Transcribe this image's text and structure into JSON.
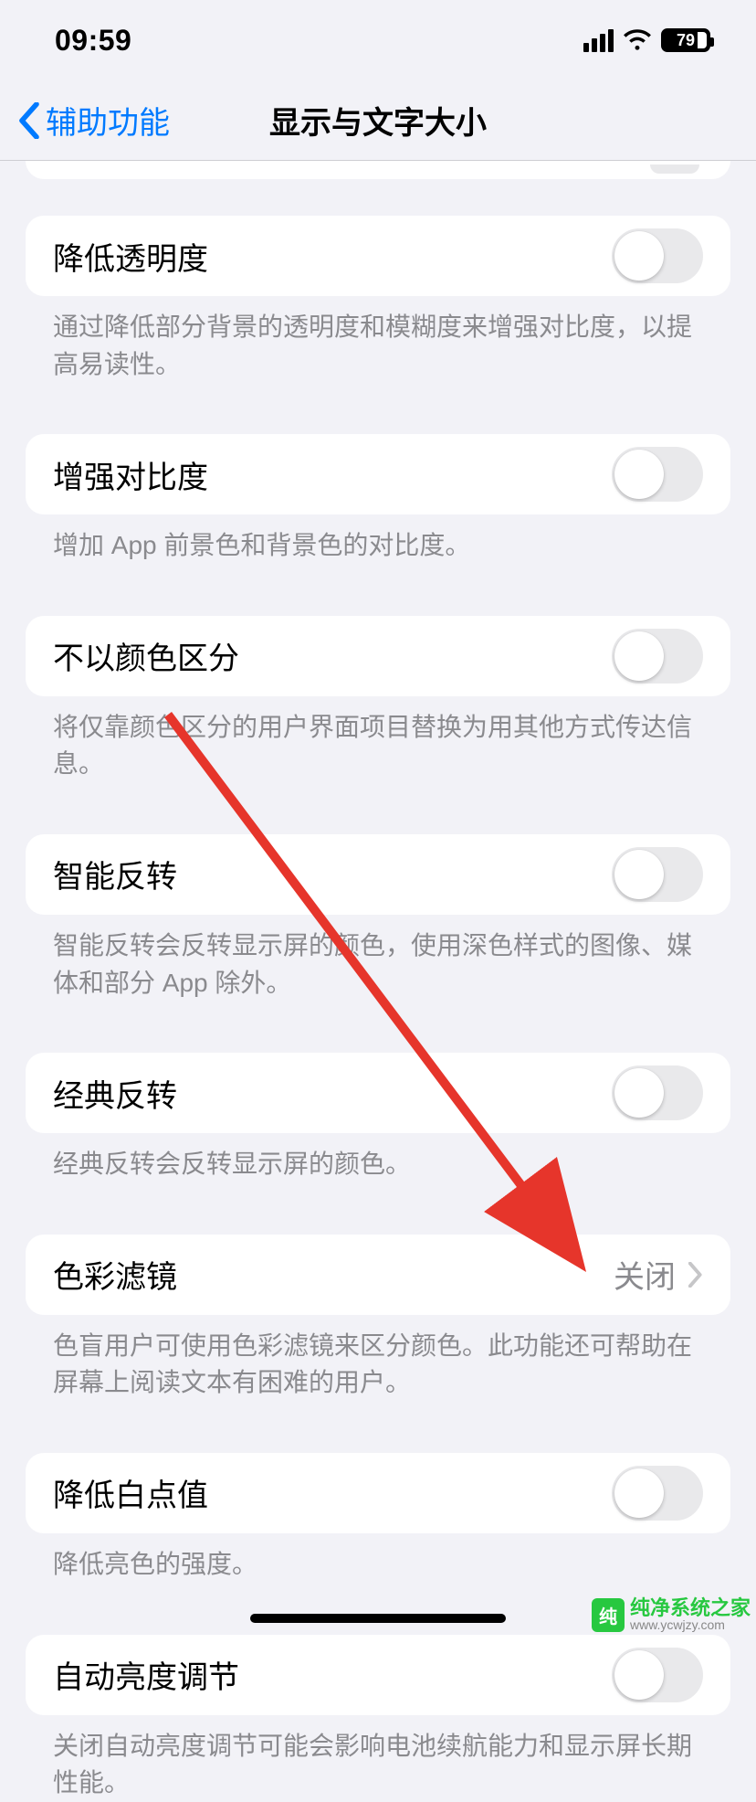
{
  "status": {
    "time": "09:59",
    "battery_percent": "79"
  },
  "nav": {
    "back_label": "辅助功能",
    "title": "显示与文字大小"
  },
  "rows": {
    "reduce_transparency": {
      "label": "降低透明度",
      "footer": "通过降低部分背景的透明度和模糊度来增强对比度，以提高易读性。"
    },
    "increase_contrast": {
      "label": "增强对比度",
      "footer": "增加 App 前景色和背景色的对比度。"
    },
    "differentiate_without_color": {
      "label": "不以颜色区分",
      "footer": "将仅靠颜色区分的用户界面项目替换为用其他方式传达信息。"
    },
    "smart_invert": {
      "label": "智能反转",
      "footer": "智能反转会反转显示屏的颜色，使用深色样式的图像、媒体和部分 App 除外。"
    },
    "classic_invert": {
      "label": "经典反转",
      "footer": "经典反转会反转显示屏的颜色。"
    },
    "color_filters": {
      "label": "色彩滤镜",
      "value": "关闭",
      "footer": "色盲用户可使用色彩滤镜来区分颜色。此功能还可帮助在屏幕上阅读文本有困难的用户。"
    },
    "reduce_white_point": {
      "label": "降低白点值",
      "footer": "降低亮色的强度。"
    },
    "auto_brightness": {
      "label": "自动亮度调节",
      "footer": "关闭自动亮度调节可能会影响电池续航能力和显示屏长期性能。"
    }
  },
  "watermark": {
    "brand": "纯净系统之家",
    "url": "www.ycwjzy.com"
  }
}
